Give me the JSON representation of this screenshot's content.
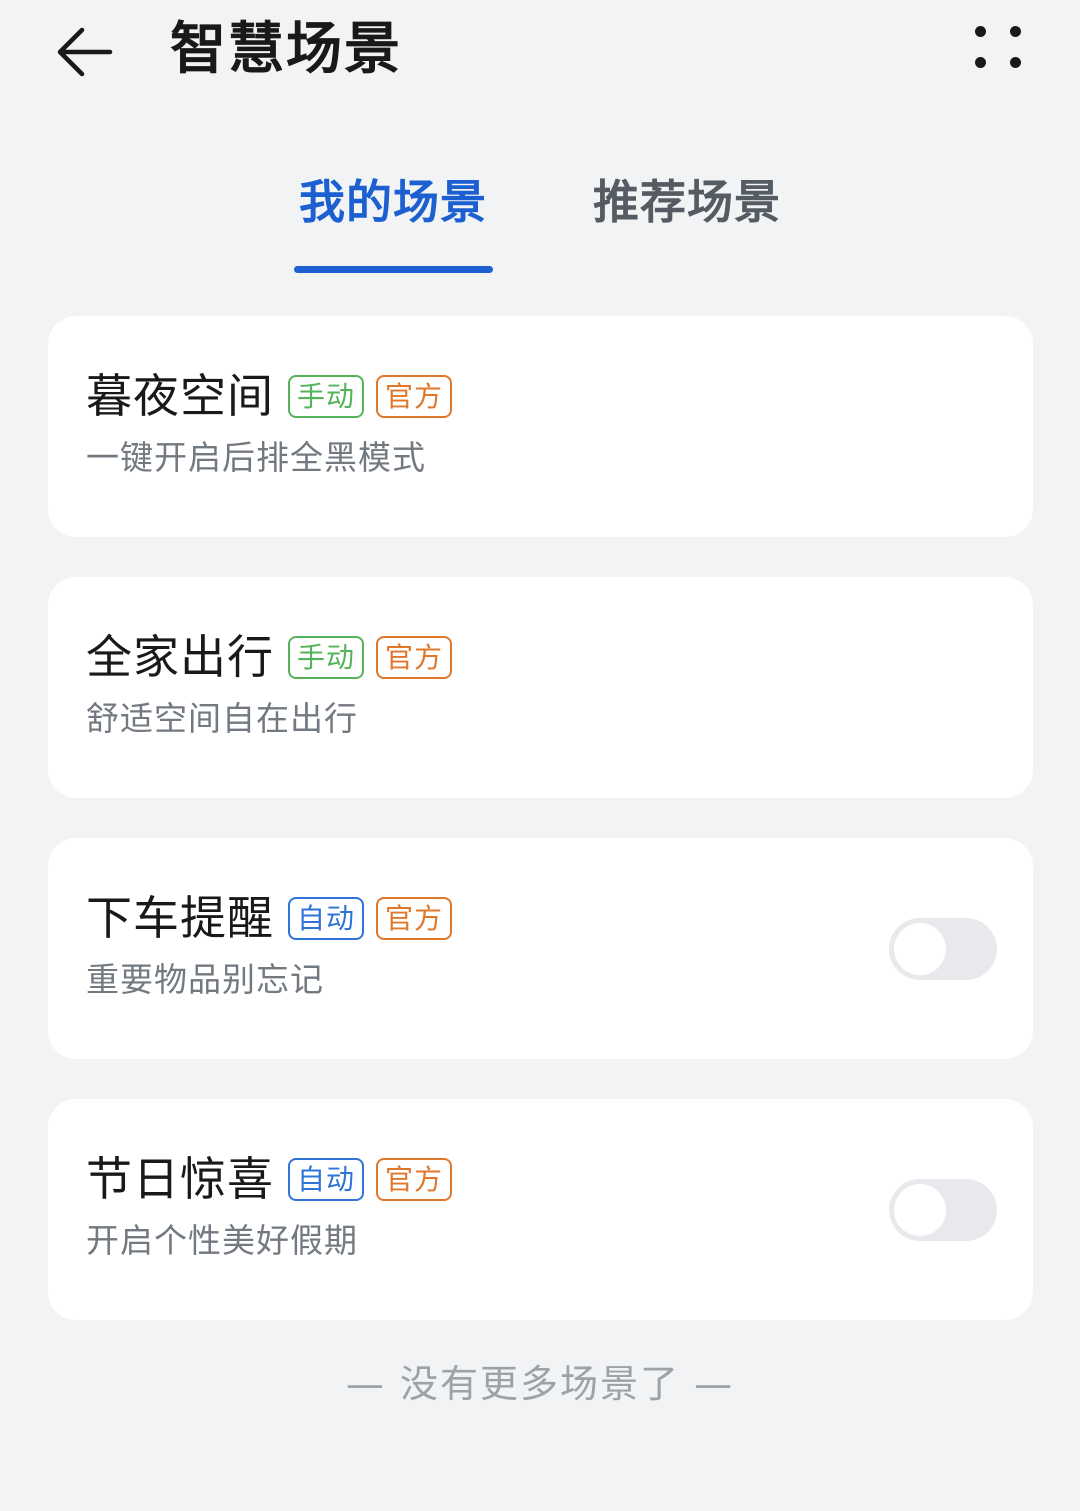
{
  "header": {
    "title": "智慧场景",
    "back_icon": "arrow-left-icon",
    "more_icon": "more-dots-icon"
  },
  "tabs": [
    {
      "label": "我的场景",
      "active": true
    },
    {
      "label": "推荐场景",
      "active": false
    }
  ],
  "scenes": [
    {
      "title": "暮夜空间",
      "mode_tag": "手动",
      "source_tag": "官方",
      "subtitle": "一键开启后排全黑模式",
      "toggle": null
    },
    {
      "title": "全家出行",
      "mode_tag": "手动",
      "source_tag": "官方",
      "subtitle": "舒适空间自在出行",
      "toggle": null
    },
    {
      "title": "下车提醒",
      "mode_tag": "自动",
      "source_tag": "官方",
      "subtitle": "重要物品别忘记",
      "toggle": false
    },
    {
      "title": "节日惊喜",
      "mode_tag": "自动",
      "source_tag": "官方",
      "subtitle": "开启个性美好假期",
      "toggle": false
    }
  ],
  "footer": {
    "text": "— 没有更多场景了 —"
  },
  "colors": {
    "accent": "#1b5fd0",
    "manual_tag": "#55b35a",
    "auto_tag": "#2f74d6",
    "official_tag": "#e0782c",
    "background": "#f1f3f5"
  }
}
